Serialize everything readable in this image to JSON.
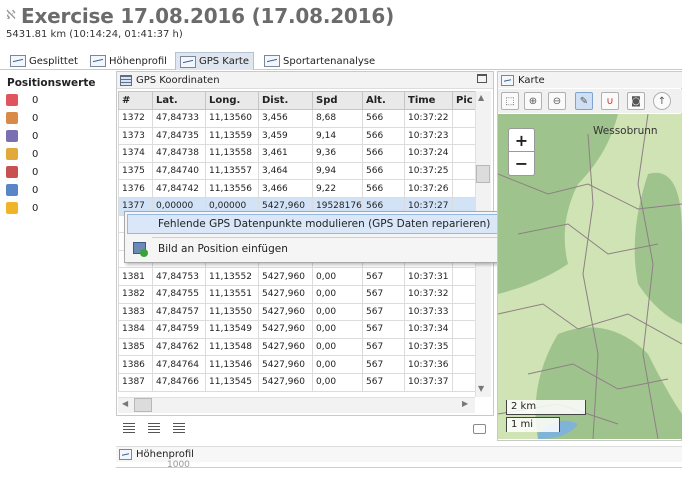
{
  "header": {
    "title": "Exercise 17.08.2016 (17.08.2016)",
    "subtitle": "5431.81 km (10:14:24, 01:41:37 h)"
  },
  "tabs": [
    {
      "label": "Gesplittet",
      "icon": "split-icon",
      "active": false
    },
    {
      "label": "Höhenprofil",
      "icon": "elevation-chart-icon",
      "active": false
    },
    {
      "label": "GPS Karte",
      "icon": "gps-map-icon",
      "active": true
    },
    {
      "label": "Sportartenanalyse",
      "icon": "sport-analysis-icon",
      "active": false
    }
  ],
  "position_panel": {
    "title": "Positionswerte",
    "items": [
      {
        "icon": "heart-icon",
        "value": "0",
        "color": "#e0545b"
      },
      {
        "icon": "speedometer-icon",
        "value": "0",
        "color": "#d98a46"
      },
      {
        "icon": "cadence-icon",
        "value": "0",
        "color": "#7a6fb0"
      },
      {
        "icon": "slope-icon",
        "value": "0",
        "color": "#e0a93a"
      },
      {
        "icon": "temperature-icon",
        "value": "0",
        "color": "#c95050"
      },
      {
        "icon": "gear-icon",
        "value": "0",
        "color": "#5a86c8"
      },
      {
        "icon": "power-icon",
        "value": "0",
        "color": "#f0b429"
      }
    ]
  },
  "gps_panel": {
    "title": "GPS Koordinaten",
    "columns": [
      "#",
      "Lat.",
      "Long.",
      "Dist.",
      "Spd",
      "Alt.",
      "Time",
      "Pic"
    ],
    "rows": [
      [
        "1372",
        "47,84733",
        "11,13560",
        "3,456",
        "8,68",
        "566",
        "10:37:22",
        ""
      ],
      [
        "1373",
        "47,84735",
        "11,13559",
        "3,459",
        "9,14",
        "566",
        "10:37:23",
        ""
      ],
      [
        "1374",
        "47,84738",
        "11,13558",
        "3,461",
        "9,36",
        "566",
        "10:37:24",
        ""
      ],
      [
        "1375",
        "47,84740",
        "11,13557",
        "3,464",
        "9,94",
        "566",
        "10:37:25",
        ""
      ],
      [
        "1376",
        "47,84742",
        "11,13556",
        "3,466",
        "9,22",
        "566",
        "10:37:26",
        ""
      ],
      [
        "1377",
        "0,00000",
        "0,00000",
        "5427,960",
        "19528176,",
        "566",
        "10:37:27",
        ""
      ],
      [
        "1378",
        "",
        "",
        "",
        "",
        "",
        "",
        ""
      ],
      [
        "1379",
        "",
        "",
        "",
        "",
        "",
        "",
        ""
      ],
      [
        "1380",
        "",
        "",
        "",
        "",
        "",
        "",
        ""
      ],
      [
        "1381",
        "47,84753",
        "11,13552",
        "5427,960",
        "0,00",
        "567",
        "10:37:31",
        ""
      ],
      [
        "1382",
        "47,84755",
        "11,13551",
        "5427,960",
        "0,00",
        "567",
        "10:37:32",
        ""
      ],
      [
        "1383",
        "47,84757",
        "11,13550",
        "5427,960",
        "0,00",
        "567",
        "10:37:33",
        ""
      ],
      [
        "1384",
        "47,84759",
        "11,13549",
        "5427,960",
        "0,00",
        "567",
        "10:37:34",
        ""
      ],
      [
        "1385",
        "47,84762",
        "11,13548",
        "5427,960",
        "0,00",
        "567",
        "10:37:35",
        ""
      ],
      [
        "1386",
        "47,84764",
        "11,13546",
        "5427,960",
        "0,00",
        "567",
        "10:37:36",
        ""
      ],
      [
        "1387",
        "47,84766",
        "11,13545",
        "5427,960",
        "0,00",
        "567",
        "10:37:37",
        ""
      ]
    ],
    "selected_row_index": 5
  },
  "context_menu": {
    "item1": "Fehlende GPS Datenpunkte modulieren (GPS Daten reparieren)",
    "item2": "Bild an Position einfügen"
  },
  "map_panel": {
    "title": "Karte",
    "place_label": "Wessobrunn",
    "zoom_in": "+",
    "zoom_out": "−",
    "scale_km": "2 km",
    "scale_mi": "1 mi",
    "colors": {
      "forest": "#9fc38d",
      "meadow": "#cfe3b4",
      "path": "#8e7f85",
      "water": "#7fb4d8"
    }
  },
  "elevation_panel": {
    "title": "Höhenprofil",
    "value_label": "1000"
  }
}
